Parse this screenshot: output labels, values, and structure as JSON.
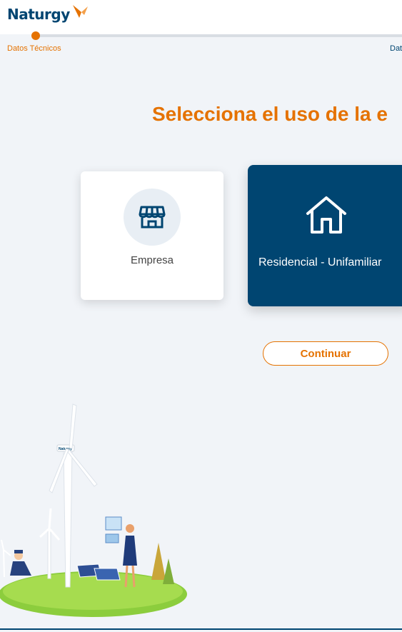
{
  "header": {
    "logo_text": "Naturgy",
    "brand_colors": {
      "primary": "#004571",
      "accent": "#e57200"
    }
  },
  "progress": {
    "steps": [
      {
        "label": "Datos Técnicos",
        "active": true
      },
      {
        "label": "Dat"
      }
    ]
  },
  "main": {
    "title": "Selecciona el uso de la e",
    "options": [
      {
        "label": "Empresa",
        "icon": "store-icon",
        "selected": false
      },
      {
        "label": "Residencial - Unifamiliar",
        "icon": "house-icon",
        "selected": true
      }
    ],
    "continue_label": "Continuar"
  },
  "illustration": {
    "turbine_brand": "Naturgy"
  }
}
